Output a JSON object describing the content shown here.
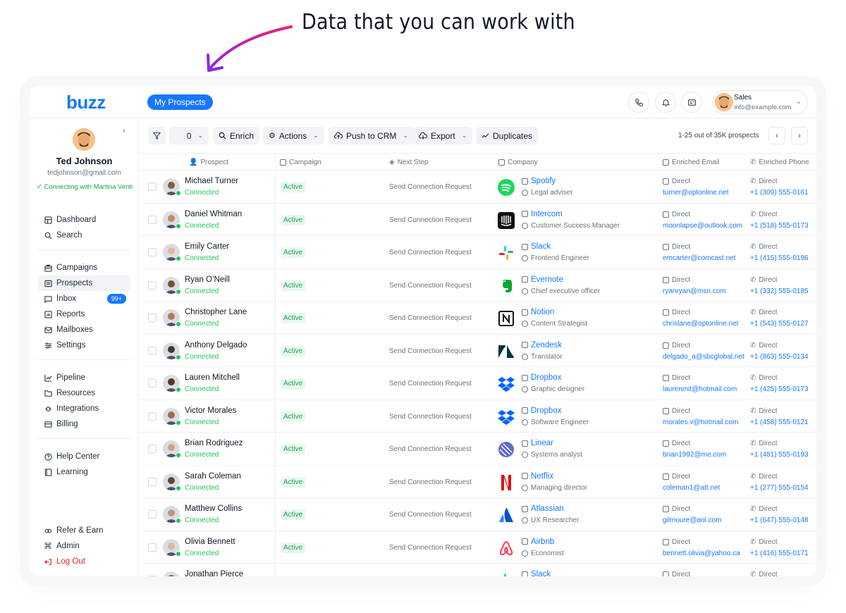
{
  "headline": "Data that you can work with",
  "app": {
    "logo": "buzz",
    "active_tab": "My Prospects",
    "user": {
      "role": "Sales",
      "email": "info@example.com"
    },
    "colors": {
      "accent": "#1677ff",
      "success": "#22c55e",
      "danger": "#dc2626"
    }
  },
  "sidebar": {
    "name": "Ted Johnson",
    "email": "tedjohnson@gmail.com",
    "status": "✓ Connecting with Martina Venti",
    "group1": [
      {
        "label": "Dashboard",
        "icon": "dashboard-icon"
      },
      {
        "label": "Search",
        "icon": "search-icon"
      }
    ],
    "group2": [
      {
        "label": "Campaigns",
        "icon": "briefcase-icon"
      },
      {
        "label": "Prospects",
        "icon": "prospects-icon",
        "active": true
      },
      {
        "label": "Inbox",
        "icon": "inbox-icon",
        "badge": "99+"
      },
      {
        "label": "Reports",
        "icon": "reports-icon"
      },
      {
        "label": "Mailboxes",
        "icon": "mail-icon"
      },
      {
        "label": "Settings",
        "icon": "settings-icon"
      }
    ],
    "group3": [
      {
        "label": "Pipeline",
        "icon": "pipeline-icon"
      },
      {
        "label": "Resources",
        "icon": "folder-icon"
      },
      {
        "label": "Integrations",
        "icon": "integrations-icon"
      },
      {
        "label": "Billing",
        "icon": "billing-icon"
      }
    ],
    "group4": [
      {
        "label": "Help Center",
        "icon": "help-icon"
      },
      {
        "label": "Learning",
        "icon": "book-icon"
      }
    ],
    "group5": [
      {
        "label": "Refer & Earn",
        "icon": "refer-icon"
      },
      {
        "label": "Admin",
        "icon": "command-icon"
      },
      {
        "label": "Log Out",
        "icon": "logout-icon"
      }
    ]
  },
  "toolbar": {
    "count": "0",
    "enrich": "Enrich",
    "actions": "Actions",
    "push": "Push to CRM",
    "export": "Export",
    "duplicates": "Duplicates",
    "pager": "1-25 out of 35K prospects"
  },
  "columns": {
    "prospect": "Prospect",
    "campaign": "Campaign",
    "next_step": "Next Step",
    "company": "Company",
    "email": "Enriched Email",
    "phone": "Enriched Phone"
  },
  "rows": [
    {
      "name": "Michael Turner",
      "conn": "Connected",
      "status": "Active",
      "step": "Send Connection Request",
      "company": "Spotify",
      "role": "Legal adviser",
      "email_label": "Direct",
      "email": "turner@optonline.net",
      "phone_label": "Direct",
      "phone": "+1 (309) 555-0161",
      "logo": "spotify"
    },
    {
      "name": "Daniel Whitman",
      "conn": "Connected",
      "status": "Active",
      "step": "Send Connection Request",
      "company": "Intercom",
      "role": "Customer Success Manager",
      "email_label": "Direct",
      "email": "moonlapse@outlook.com",
      "phone_label": "Direct",
      "phone": "+1 (518) 555-0173",
      "logo": "intercom"
    },
    {
      "name": "Emily Carter",
      "conn": "Connected",
      "status": "Active",
      "step": "Send Connection Request",
      "company": "Slack",
      "role": "Frontend Engineer",
      "email_label": "Direct",
      "email": "emcarter@comcast.net",
      "phone_label": "Direct",
      "phone": "+1 (415) 555-0196",
      "logo": "slack"
    },
    {
      "name": "Ryan O’Neill",
      "conn": "Connected",
      "status": "Active",
      "step": "Send Connection Request",
      "company": "Evernote",
      "role": "Chief executive officer",
      "email_label": "Direct",
      "email": "ryanryan@msn.com",
      "phone_label": "Direct",
      "phone": "+1 (332) 555-0185",
      "logo": "evernote"
    },
    {
      "name": "Christopher Lane",
      "conn": "Connected",
      "status": "Active",
      "step": "Send Connection Request",
      "company": "Notion",
      "role": "Content Strategist",
      "email_label": "Direct",
      "email": "chrislane@optonline.net",
      "phone_label": "Direct",
      "phone": "+1 (543) 555-0127",
      "logo": "notion"
    },
    {
      "name": "Anthony Delgado",
      "conn": "Connected",
      "status": "Active",
      "step": "Send Connection Request",
      "company": "Zendesk",
      "role": "Translator",
      "email_label": "Direct",
      "email": "delgado_a@sbcglobal.net",
      "phone_label": "Direct",
      "phone": "+1 (863) 555-0134",
      "logo": "zendesk"
    },
    {
      "name": "Lauren Mitchell",
      "conn": "Connected",
      "status": "Active",
      "step": "Send Connection Request",
      "company": "Dropbox",
      "role": "Graphic designer",
      "email_label": "Direct",
      "email": "laurenmit@hotmail.com",
      "phone_label": "Direct",
      "phone": "+1 (425) 555-0173",
      "logo": "dropbox"
    },
    {
      "name": "Victor Morales",
      "conn": "Connected",
      "status": "Active",
      "step": "Send Connection Request",
      "company": "Dropbox",
      "role": "Software Engineer",
      "email_label": "Direct",
      "email": "morales.v@hotmail.com",
      "phone_label": "Direct",
      "phone": "+1 (458) 555-0121",
      "logo": "dropbox"
    },
    {
      "name": "Brian Rodriguez",
      "conn": "Connected",
      "status": "Active",
      "step": "Send Connection Request",
      "company": "Linear",
      "role": "Systems analyst",
      "email_label": "Direct",
      "email": "brian1992@me.com",
      "phone_label": "Direct",
      "phone": "+1 (481) 555-0193",
      "logo": "linear"
    },
    {
      "name": "Sarah Coleman",
      "conn": "Connected",
      "status": "Active",
      "step": "Send Connection Request",
      "company": "Netflix",
      "role": "Managing director",
      "email_label": "Direct",
      "email": "coleman1@att.net",
      "phone_label": "Direct",
      "phone": "+1 (277) 555-0154",
      "logo": "netflix"
    },
    {
      "name": "Matthew Collins",
      "conn": "Connected",
      "status": "Active",
      "step": "Send Connection Request",
      "company": "Atlassian",
      "role": "UX Researcher",
      "email_label": "Direct",
      "email": "gilmoure@aol.com",
      "phone_label": "Direct",
      "phone": "+1 (647) 555-0148",
      "logo": "atlassian"
    },
    {
      "name": "Olivia Bennett",
      "conn": "Connected",
      "status": "Active",
      "step": "Send Connection Request",
      "company": "Airbnb",
      "role": "Economist",
      "email_label": "Direct",
      "email": "bennett.olivia@yahoo.ca",
      "phone_label": "Direct",
      "phone": "+1 (416) 555-0171",
      "logo": "airbnb"
    },
    {
      "name": "Jonathan Pierce",
      "conn": "",
      "status": "",
      "step": "",
      "company": "Slack",
      "role": "",
      "email_label": "Direct",
      "email": "",
      "phone_label": "Direct",
      "phone": "",
      "logo": "slack"
    }
  ]
}
